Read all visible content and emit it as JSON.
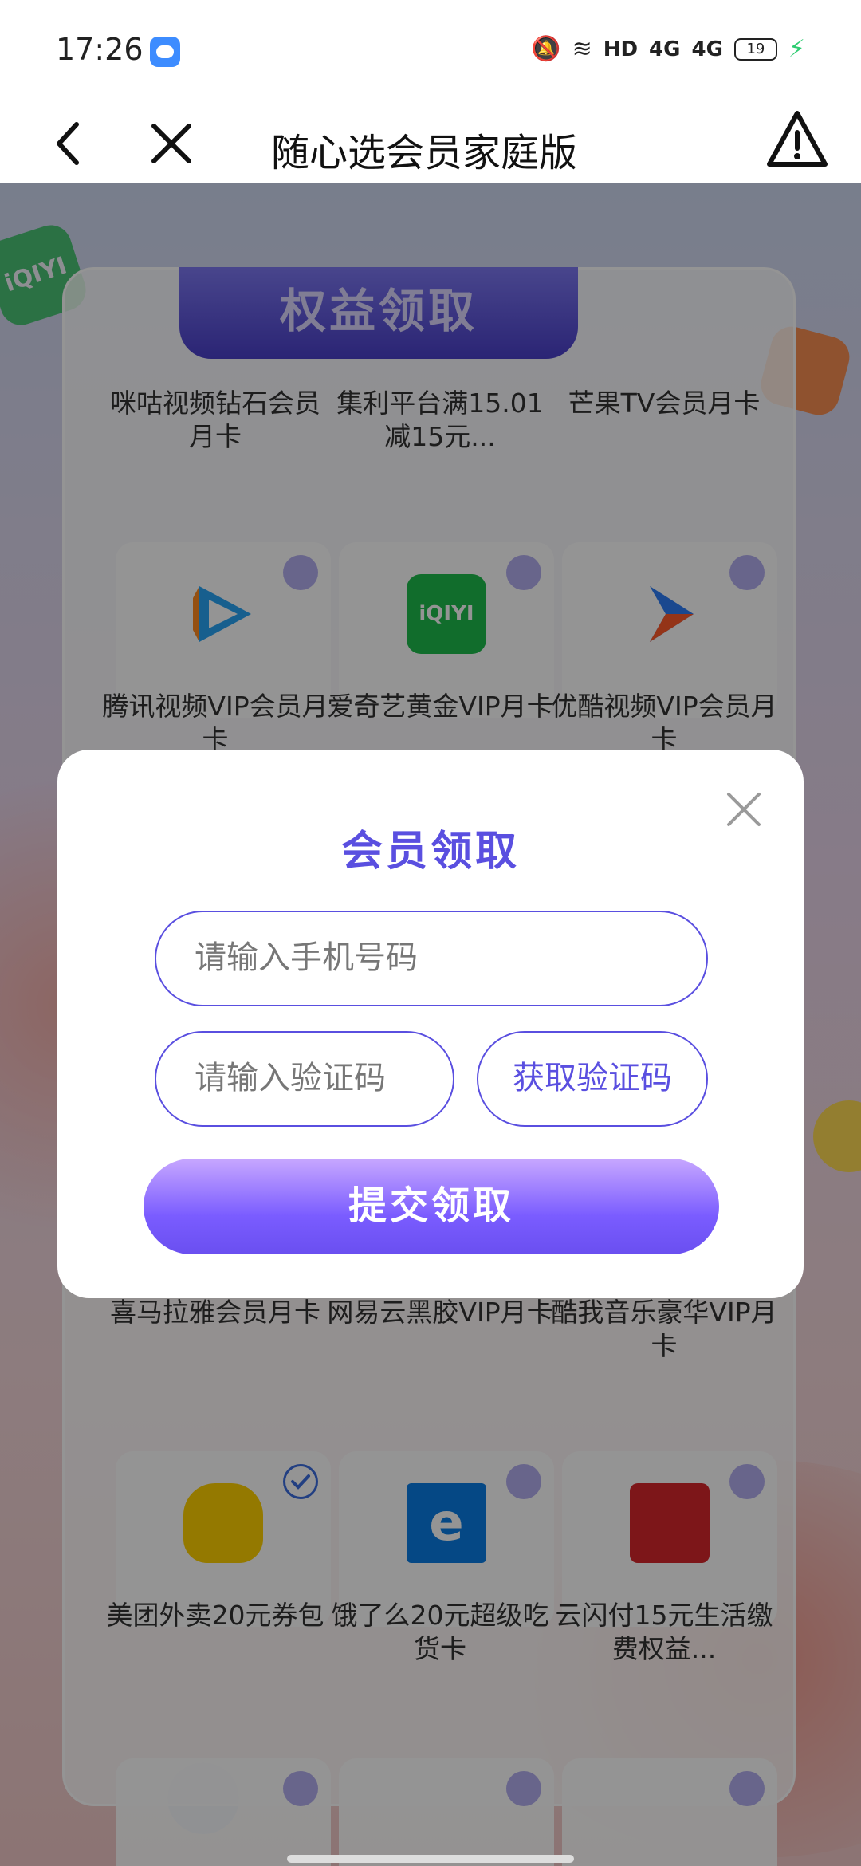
{
  "status_bar": {
    "time": "17:26",
    "network": "HD",
    "signal1": "4G",
    "signal2": "4G",
    "battery": "19"
  },
  "nav": {
    "title": "随心选会员家庭版"
  },
  "panel": {
    "header": "权益领取",
    "items": [
      {
        "label": "咪咕视频钻石会员月卡"
      },
      {
        "label": "集利平台满15.01减15元..."
      },
      {
        "label": "芒果TV会员月卡"
      },
      {
        "label": "腾讯视频VIP会员月卡",
        "icon": "tencent-video-icon"
      },
      {
        "label": "爱奇艺黄金VIP月卡",
        "icon": "iqiyi-icon"
      },
      {
        "label": "优酷视频VIP会员月卡",
        "icon": "youku-icon"
      },
      {
        "label": "喜马拉雅会员月卡"
      },
      {
        "label": "网易云黑胶VIP月卡"
      },
      {
        "label": "酷我音乐豪华VIP月卡"
      },
      {
        "label": "美团外卖20元券包",
        "icon": "meituan-icon",
        "selected": true
      },
      {
        "label": "饿了么20元超级吃货卡",
        "icon": "eleme-icon"
      },
      {
        "label": "云闪付15元生活缴费权益...",
        "icon": "unionpay-icon"
      }
    ]
  },
  "modal": {
    "title": "会员领取",
    "phone_placeholder": "请输入手机号码",
    "code_placeholder": "请输入验证码",
    "get_code_label": "获取验证码",
    "submit_label": "提交领取"
  },
  "colors": {
    "accent": "#5a4fe0",
    "header_purple": "#4a3fc9"
  }
}
